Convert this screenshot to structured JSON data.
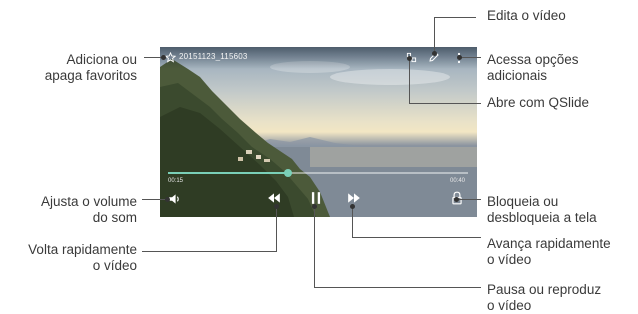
{
  "video": {
    "filename": "20151123_115603",
    "time_elapsed": "00:15",
    "time_total": "00:40",
    "progress": 0.4,
    "accent_color": "#7ad0b8"
  },
  "icons": {
    "favorite": "star-icon",
    "edit": "pencil-icon",
    "more": "more-options-icon",
    "qslide": "qslide-icon",
    "volume": "volume-icon",
    "rewind": "rewind-icon",
    "pause": "pause-icon",
    "fast_forward": "fast-forward-icon",
    "lock": "lock-icon"
  },
  "callouts": {
    "favorites": [
      "Adiciona ou",
      "apaga favoritos"
    ],
    "volume": [
      "Ajusta o volume",
      "do som"
    ],
    "rewind": [
      "Volta rapidamente",
      "o vídeo"
    ],
    "edit": [
      "Edita o vídeo"
    ],
    "more": [
      "Acessa opções",
      "adicionais"
    ],
    "qslide": [
      "Abre com QSlide"
    ],
    "lock": [
      "Bloqueia ou",
      "desbloqueia a tela"
    ],
    "fast_forward": [
      "Avança rapidamente",
      "o vídeo"
    ],
    "pause": [
      "Pausa ou reproduz",
      "o vídeo"
    ]
  }
}
